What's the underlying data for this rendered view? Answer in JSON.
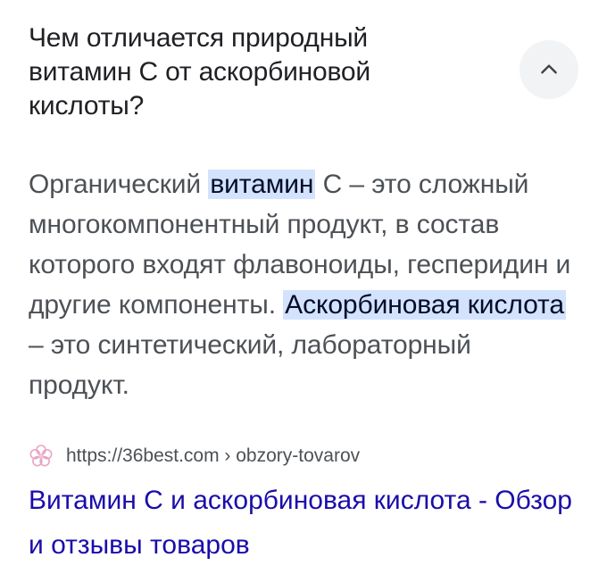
{
  "question": {
    "text": "Чем отличается природный витамин С от аскорбиновой кислоты?",
    "toggle_icon": "chevron-up-icon"
  },
  "answer": {
    "part1": "Органический ",
    "highlight1": "витамин",
    "part2": " С – это сложный многокомпонентный продукт, в состав которого входят флавоноиды, гесперидин и другие компоненты. ",
    "highlight2": "Аскорбиновая кислота",
    "part3": " – это синтетический, лабораторный продукт."
  },
  "source": {
    "favicon": "flower-icon",
    "url": "https://36best.com › obzory-tovarov"
  },
  "result": {
    "title": "Витамин С и аскорбиновая кислота - Обзор и отзывы товаров"
  },
  "colors": {
    "highlight_bg": "#d3e3fd",
    "link": "#1a0dab",
    "text": "#4d5156",
    "heading": "#202124",
    "favicon": "#e8a5c3"
  }
}
